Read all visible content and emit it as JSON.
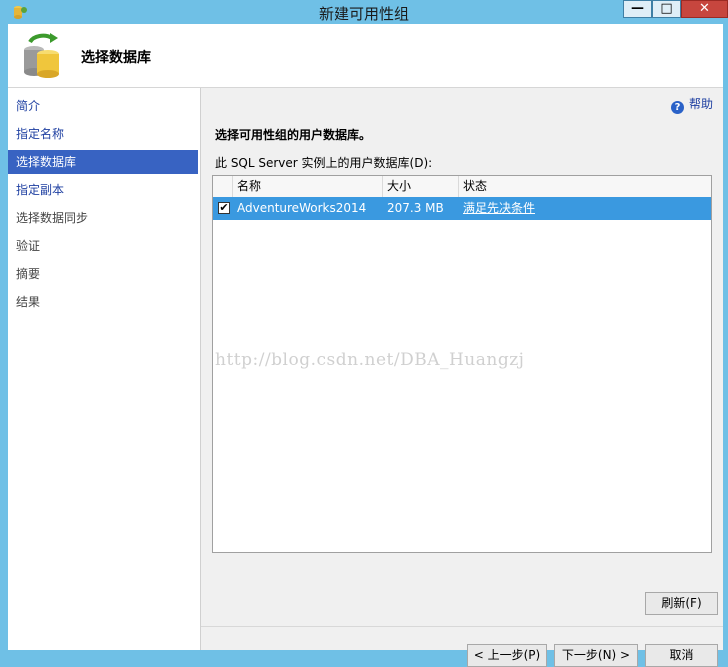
{
  "window": {
    "title": "新建可用性组"
  },
  "header": {
    "title": "选择数据库"
  },
  "nav": {
    "items": [
      {
        "label": "简介"
      },
      {
        "label": "指定名称"
      },
      {
        "label": "选择数据库"
      },
      {
        "label": "指定副本"
      },
      {
        "label": "选择数据同步"
      },
      {
        "label": "验证"
      },
      {
        "label": "摘要"
      },
      {
        "label": "结果"
      }
    ]
  },
  "main": {
    "help_label": "帮助",
    "section_title": "选择可用性组的用户数据库。",
    "list_label": "此 SQL Server 实例上的用户数据库(D):",
    "columns": [
      "名称",
      "大小",
      "状态"
    ],
    "rows": [
      {
        "checked": true,
        "name": "AdventureWorks2014",
        "size": "207.3 MB",
        "status": "满足先决条件"
      }
    ],
    "watermark": "http://blog.csdn.net/DBA_Huangzj",
    "refresh_label": "刷新(F)"
  },
  "footer": {
    "prev_label": "< 上一步(P)",
    "next_label": "下一步(N) >",
    "cancel_label": "取消"
  },
  "colors": {
    "titlebar": "#6fc0e6",
    "nav_active": "#3863c2",
    "row_selected": "#3a99e0",
    "link": "#1e3fa1"
  }
}
